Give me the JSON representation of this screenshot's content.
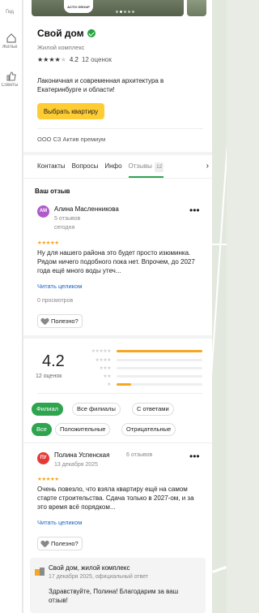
{
  "rail": {
    "items": [
      {
        "label": "Гид",
        "icon": "guide-icon"
      },
      {
        "label": "Жильё",
        "icon": "house-icon"
      },
      {
        "label": "Советы",
        "icon": "thumbs-up-icon"
      }
    ]
  },
  "photos": {
    "logo_text": "ACTIV GROUP",
    "active_dot": 1
  },
  "org": {
    "title": "Свой дом",
    "category": "Жилой комплекс",
    "rating": "4.2",
    "rating_stars": 4,
    "rating_count": "12 оценок",
    "description": "Лаконичная и современная архитектура в Екатеринбурге и области!",
    "cta_label": "Выбрать квартиру",
    "company": "ООО СЗ Актив премиум"
  },
  "tabs": {
    "items": [
      "Контакты",
      "Вопросы",
      "Инфо",
      "Отзывы"
    ],
    "active": "Отзывы",
    "reviews_count": "12",
    "next": "›"
  },
  "your_review": {
    "heading": "Ваш отзыв",
    "author": "Алина Масленникова",
    "initials": "AM",
    "avatar_color": "#b05bc9",
    "reviews": "5 отзывов",
    "date": "сегодня",
    "stars": 5,
    "text": "Ну для нашего района это будет просто изюминка. Рядом ничего подобного пока нет. Впрочем, до 2027 года ещё много воды утеч...",
    "read_more": "Читать целиком",
    "views": "0 просмотров",
    "helpful": "Полезно?"
  },
  "summary": {
    "rating": "4.2",
    "count": "12 оценок"
  },
  "distribution": [
    {
      "stars": 5,
      "fraction": 1.0
    },
    {
      "stars": 4,
      "fraction": 0.0
    },
    {
      "stars": 3,
      "fraction": 0.0
    },
    {
      "stars": 2,
      "fraction": 0.0
    },
    {
      "stars": 1,
      "fraction": 0.17
    }
  ],
  "filters": {
    "scope": [
      {
        "label": "Филиал",
        "on": true
      },
      {
        "label": "Все филиалы",
        "on": false
      },
      {
        "label": "С ответами",
        "on": false
      }
    ],
    "tone": [
      {
        "label": "Все",
        "on": true
      },
      {
        "label": "Положительные",
        "on": false
      },
      {
        "label": "Отрицательные",
        "on": false
      }
    ]
  },
  "review2": {
    "author": "Полина Успенская",
    "initials": "ПУ",
    "avatar_color": "#e53935",
    "reviews": "6 отзывов",
    "date": "13 декабря 2025",
    "stars": 5,
    "text": "Очень повезло, что взяла квартиру ещё на самом старте строительства. Сдача только в 2027-ом, и за это время всё порядком...",
    "read_more": "Читать целиком",
    "helpful": "Полезно?"
  },
  "owner_reply": {
    "name": "Свой дом, жилой комплекс",
    "date": "17 декабря 2025, официальный ответ",
    "text": "Здравствуйте, Полина! Благодарим за ваш отзыв!"
  },
  "colors": {
    "accent": "#2ea44f",
    "cta": "#ffcc33",
    "link": "#1a64c6",
    "star": "#f5a623"
  }
}
